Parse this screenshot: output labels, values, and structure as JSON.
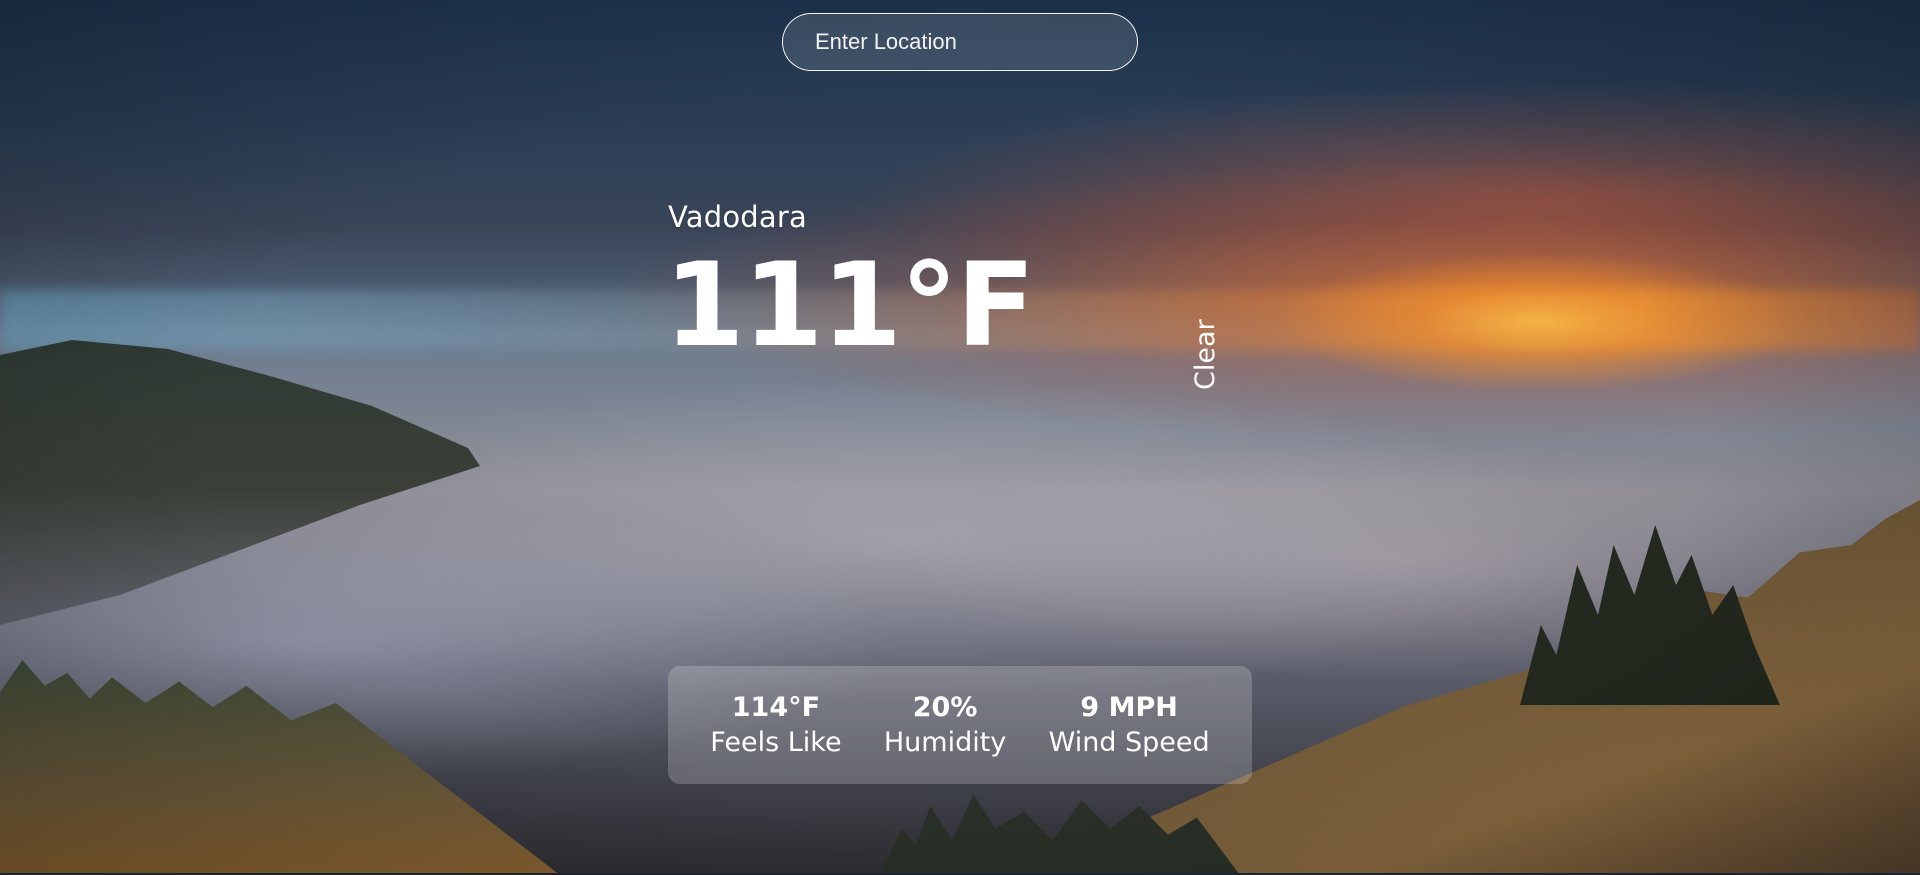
{
  "search": {
    "placeholder": "Enter Location",
    "value": ""
  },
  "weather": {
    "location": "Vadodara",
    "temperature": "111°F",
    "description": "Clear"
  },
  "details": {
    "feels_like": {
      "value": "114°F",
      "label": "Feels Like"
    },
    "humidity": {
      "value": "20%",
      "label": "Humidity"
    },
    "wind_speed": {
      "value": "9 MPH",
      "label": "Wind Speed"
    }
  },
  "colors": {
    "text": "#ffffff",
    "card_background": "rgba(255,255,255,0.2)",
    "sunset_accent": "#f0a030"
  }
}
